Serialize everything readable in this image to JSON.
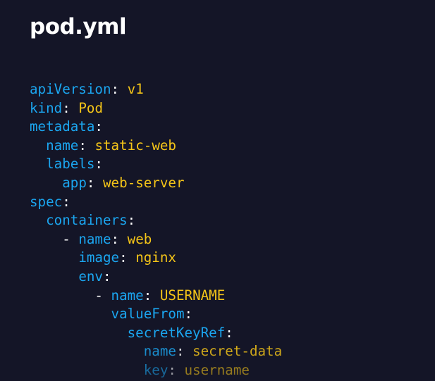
{
  "title": "pod.yml",
  "colors": {
    "background": "#141527",
    "key": "#1ba6f0",
    "value": "#f5c518",
    "punctuation": "#ffffff"
  },
  "code_lines": [
    {
      "indent": "",
      "dash": "",
      "key": "apiVersion",
      "colon": ":",
      "value": "v1"
    },
    {
      "indent": "",
      "dash": "",
      "key": "kind",
      "colon": ":",
      "value": "Pod"
    },
    {
      "indent": "",
      "dash": "",
      "key": "metadata",
      "colon": ":",
      "value": ""
    },
    {
      "indent": "  ",
      "dash": "",
      "key": "name",
      "colon": ":",
      "value": "static-web"
    },
    {
      "indent": "  ",
      "dash": "",
      "key": "labels",
      "colon": ":",
      "value": ""
    },
    {
      "indent": "    ",
      "dash": "",
      "key": "app",
      "colon": ":",
      "value": "web-server"
    },
    {
      "indent": "",
      "dash": "",
      "key": "spec",
      "colon": ":",
      "value": ""
    },
    {
      "indent": "  ",
      "dash": "",
      "key": "containers",
      "colon": ":",
      "value": ""
    },
    {
      "indent": "    ",
      "dash": "- ",
      "key": "name",
      "colon": ":",
      "value": "web"
    },
    {
      "indent": "      ",
      "dash": "",
      "key": "image",
      "colon": ":",
      "value": "nginx"
    },
    {
      "indent": "      ",
      "dash": "",
      "key": "env",
      "colon": ":",
      "value": ""
    },
    {
      "indent": "        ",
      "dash": "- ",
      "key": "name",
      "colon": ":",
      "value": "USERNAME"
    },
    {
      "indent": "          ",
      "dash": "",
      "key": "valueFrom",
      "colon": ":",
      "value": ""
    },
    {
      "indent": "            ",
      "dash": "",
      "key": "secretKeyRef",
      "colon": ":",
      "value": ""
    },
    {
      "indent": "              ",
      "dash": "",
      "key": "name",
      "colon": ":",
      "value": "secret-data"
    },
    {
      "indent": "              ",
      "dash": "",
      "key": "key",
      "colon": ":",
      "value": "username"
    }
  ]
}
